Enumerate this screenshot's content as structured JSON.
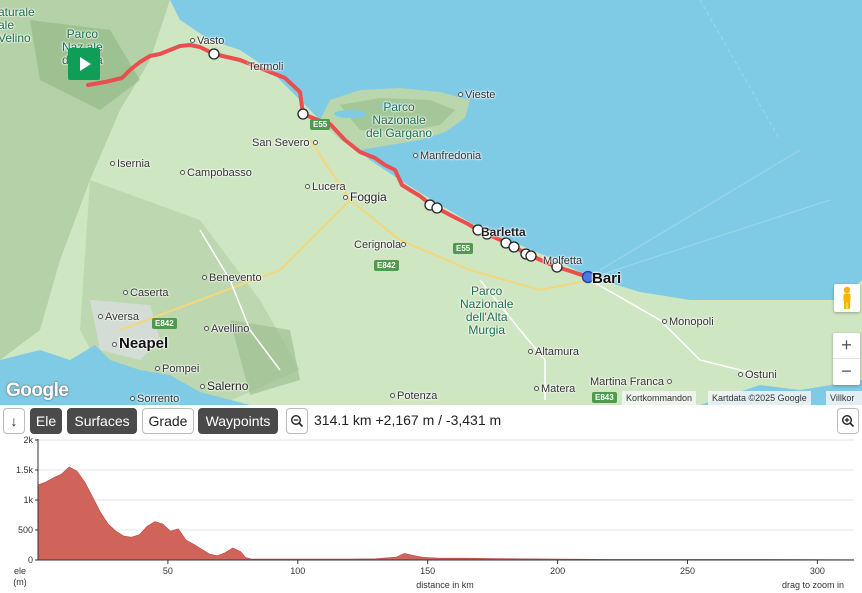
{
  "map": {
    "places": [
      {
        "id": "vasto",
        "label": "Vasto",
        "dot": true
      },
      {
        "id": "termoli",
        "label": "Termoli",
        "dot": false
      },
      {
        "id": "vieste",
        "label": "Vieste",
        "dot": true
      },
      {
        "id": "san-severo",
        "label": "San Severo",
        "dot": true
      },
      {
        "id": "manfredonia",
        "label": "Manfredonia",
        "dot": true
      },
      {
        "id": "isernia",
        "label": "Isernia",
        "dot": true
      },
      {
        "id": "campobasso",
        "label": "Campobasso",
        "dot": true
      },
      {
        "id": "lucera",
        "label": "Lucera",
        "dot": true
      },
      {
        "id": "foggia",
        "label": "Foggia",
        "dot": true
      },
      {
        "id": "barletta",
        "label": "Barletta",
        "dot": false
      },
      {
        "id": "cerignola",
        "label": "Cerignola",
        "dot": true
      },
      {
        "id": "molfetta",
        "label": "Molfetta",
        "dot": false
      },
      {
        "id": "bari",
        "label": "Bari",
        "dot": false
      },
      {
        "id": "benevento",
        "label": "Benevento",
        "dot": true
      },
      {
        "id": "caserta",
        "label": "Caserta",
        "dot": true
      },
      {
        "id": "aversa",
        "label": "Aversa",
        "dot": true
      },
      {
        "id": "avellino",
        "label": "Avellino",
        "dot": true
      },
      {
        "id": "neapel",
        "label": "Neapel",
        "dot": true
      },
      {
        "id": "pompei",
        "label": "Pompei",
        "dot": true
      },
      {
        "id": "salerno",
        "label": "Salerno",
        "dot": true
      },
      {
        "id": "sorrento",
        "label": "Sorrento",
        "dot": true
      },
      {
        "id": "potenza",
        "label": "Potenza",
        "dot": true
      },
      {
        "id": "altamura",
        "label": "Altamura",
        "dot": true
      },
      {
        "id": "matera",
        "label": "Matera",
        "dot": true
      },
      {
        "id": "monopoli",
        "label": "Monopoli",
        "dot": true
      },
      {
        "id": "martina-franca",
        "label": "Martina Franca",
        "dot": true
      },
      {
        "id": "ostuni",
        "label": "Ostuni",
        "dot": true
      }
    ],
    "parks": {
      "gargano": "Parco\nNazionale\ndel Gargano",
      "alta_murgia": "Parco\nNazionale\ndell'Alta\nMurgia",
      "majella": "Parco\nNaz  ale\ndell   ella",
      "velino": "aturale\nale\nVelino"
    },
    "shields": {
      "e55_a": "E55",
      "e55_b": "E55",
      "e842_a": "E842",
      "e842_b": "E842",
      "e843": "E843"
    },
    "google_logo": "Google",
    "attribution": {
      "shortcuts": "Kortkommandon",
      "data": "Kartdata ©2025 Google",
      "terms": "Villkor"
    },
    "zoom": {
      "in": "+",
      "out": "−"
    },
    "colors": {
      "route": "#ea4f4f",
      "sea": "#7fcbe6",
      "land": "#cfe6c3",
      "end_marker": "#4a7be0"
    }
  },
  "toolbar": {
    "collapse": "↓",
    "ele": "Ele",
    "surfaces": "Surfaces",
    "grade": "Grade",
    "waypoints": "Waypoints",
    "stats": "314.1 km +2,167 m / -3,431 m"
  },
  "elevation": {
    "y_label": "ele",
    "y_unit": "(m)",
    "x_label": "distance in km",
    "hint": "drag to zoom in",
    "y_ticks": [
      "2k",
      "1.5k",
      "1k",
      "500",
      "0"
    ],
    "x_ticks": [
      "50",
      "100",
      "150",
      "200",
      "250",
      "300"
    ],
    "fill_color": "#d0645a"
  },
  "chart_data": {
    "type": "area",
    "xlabel": "distance in km",
    "ylabel": "ele (m)",
    "xlim": [
      0,
      314.1
    ],
    "ylim": [
      0,
      2000
    ],
    "x": [
      0,
      3,
      6,
      9,
      12,
      15,
      18,
      21,
      24,
      27,
      30,
      33,
      36,
      39,
      42,
      45,
      48,
      51,
      54,
      57,
      60,
      63,
      66,
      69,
      72,
      75,
      78,
      80,
      82,
      85,
      90,
      100,
      110,
      120,
      130,
      138,
      141,
      144,
      148,
      155,
      165,
      175,
      185,
      200,
      220,
      240,
      260,
      280,
      300,
      314
    ],
    "values": [
      1250,
      1300,
      1370,
      1430,
      1550,
      1480,
      1300,
      1050,
      800,
      600,
      480,
      400,
      380,
      420,
      560,
      640,
      600,
      480,
      520,
      330,
      260,
      180,
      100,
      70,
      120,
      200,
      140,
      40,
      15,
      15,
      15,
      15,
      15,
      15,
      20,
      50,
      110,
      80,
      45,
      30,
      30,
      25,
      20,
      15,
      10,
      10,
      10,
      10,
      8,
      5
    ]
  }
}
